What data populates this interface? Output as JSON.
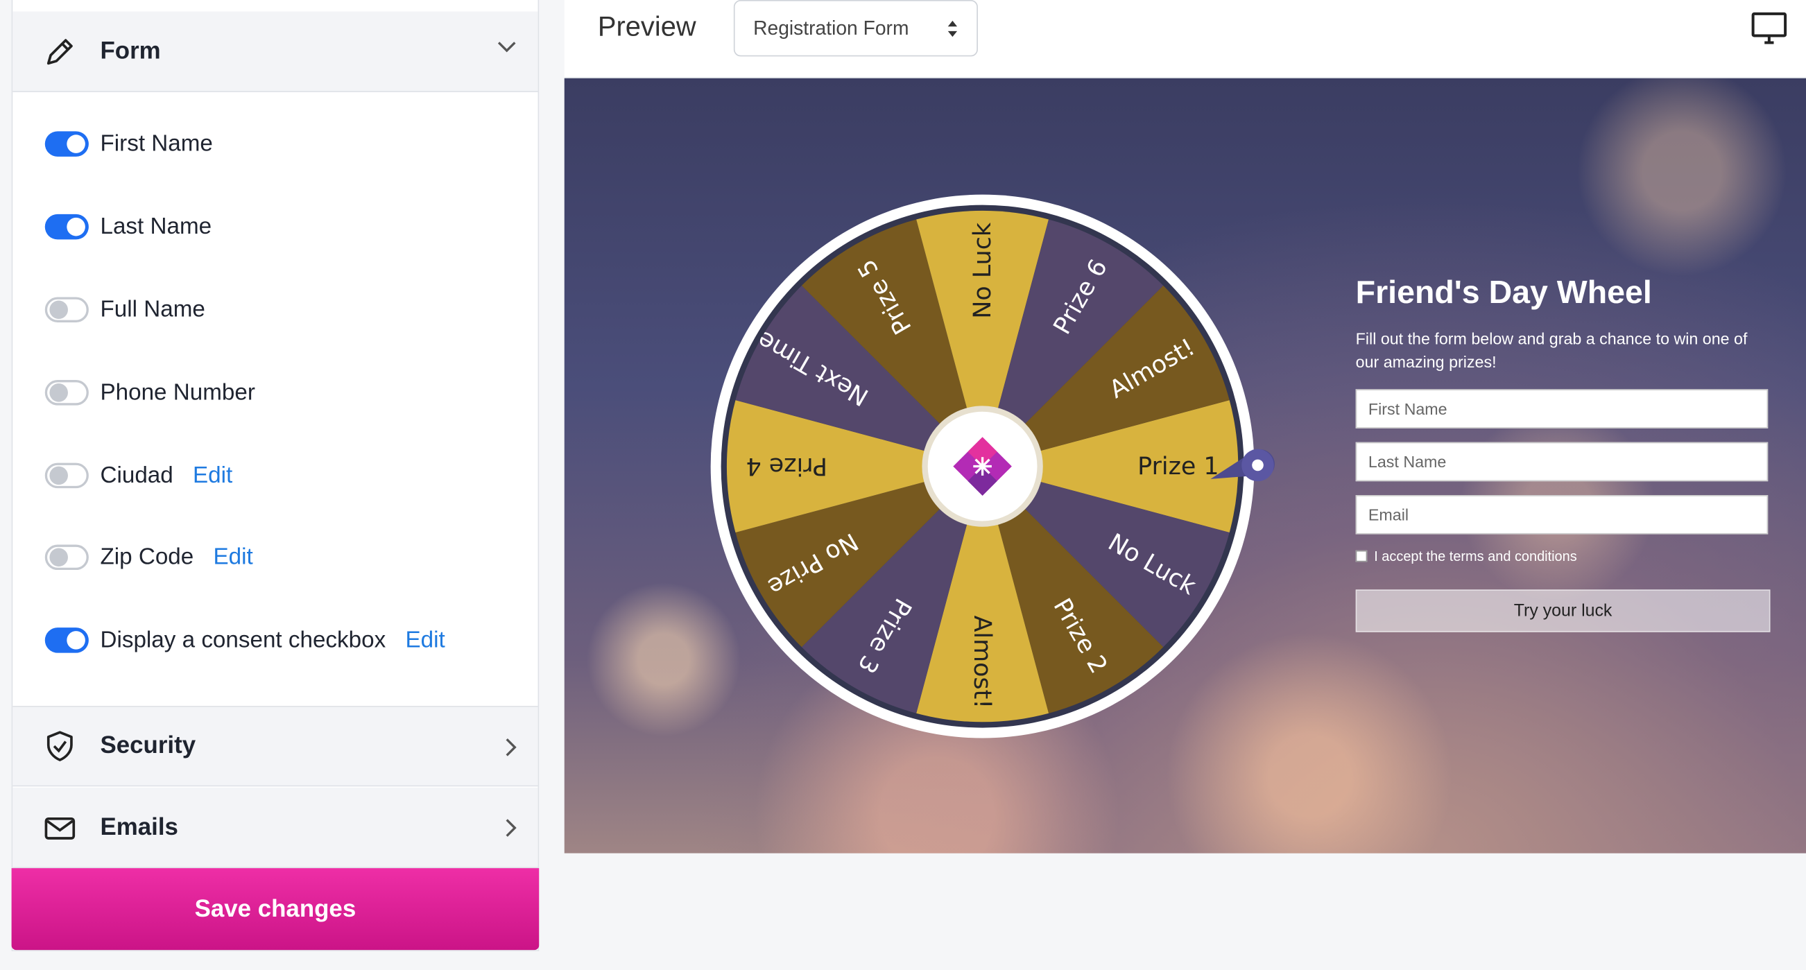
{
  "sidebar": {
    "form_section": {
      "title": "Form"
    },
    "fields": [
      {
        "label": "First Name",
        "enabled": true,
        "edit": ""
      },
      {
        "label": "Last Name",
        "enabled": true,
        "edit": ""
      },
      {
        "label": "Full Name",
        "enabled": false,
        "edit": ""
      },
      {
        "label": "Phone Number",
        "enabled": false,
        "edit": ""
      },
      {
        "label": "Ciudad",
        "enabled": false,
        "edit": "Edit"
      },
      {
        "label": "Zip Code",
        "enabled": false,
        "edit": "Edit"
      },
      {
        "label": "Display a consent checkbox",
        "enabled": true,
        "edit": "Edit"
      }
    ],
    "security_section": {
      "title": "Security"
    },
    "emails_section": {
      "title": "Emails"
    },
    "save_label": "Save changes"
  },
  "preview": {
    "title": "Preview",
    "form_select": "Registration Form",
    "icons": {
      "device": "desktop-monitor-icon"
    }
  },
  "wheel": {
    "slices": [
      "Prize 1",
      "No Luck",
      "Prize 2",
      "Almost!",
      "Prize 3",
      "No Prize",
      "Prize 4",
      "Next Time",
      "Prize 5",
      "No Luck",
      "Prize 6",
      "Almost!"
    ],
    "colors": {
      "gold": "#d8b33e",
      "purple": "#54476b",
      "brown": "#77591f",
      "rim": "#ffffff",
      "pointer": "#4d4a8e"
    }
  },
  "signup": {
    "title": "Friend's Day Wheel",
    "description": "Fill out the form below and grab a chance to win one of our amazing prizes!",
    "first_name_placeholder": "First Name",
    "last_name_placeholder": "Last Name",
    "email_placeholder": "Email",
    "terms_label": "I accept the terms and conditions",
    "button_label": "Try your luck"
  },
  "colors": {
    "accent_blue": "#1e6ef2",
    "save_pink": "#e0209a"
  }
}
